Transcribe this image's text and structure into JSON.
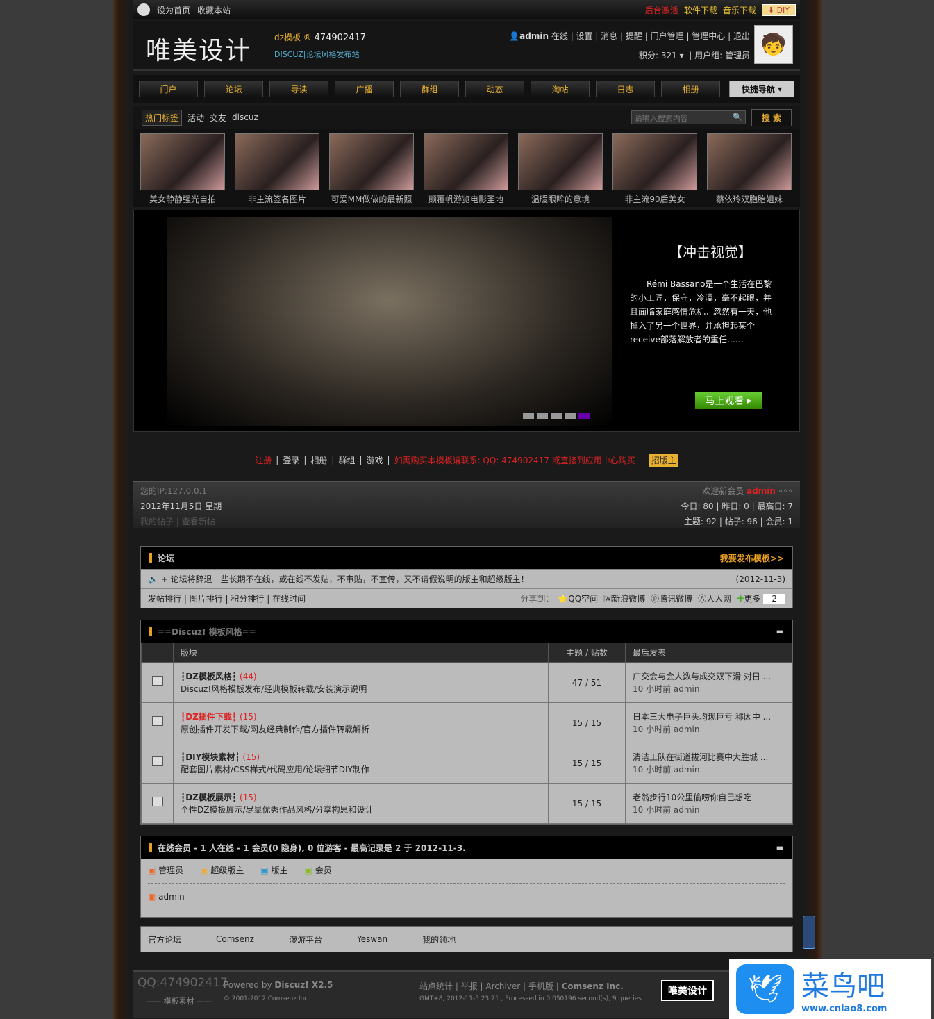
{
  "topbar": {
    "set_home": "设为首页",
    "bookmark": "收藏本站",
    "links": [
      "后台激活",
      "软件下载",
      "音乐下载"
    ],
    "diy": "DIY"
  },
  "header": {
    "logo": "唯美设计",
    "brand": "dz模板",
    "qq": "474902417",
    "tagline": "DISCUZ|论坛风格发布站",
    "user": "admin",
    "status": "在线",
    "menu": [
      "设置",
      "消息",
      "提醒",
      "门户管理",
      "管理中心",
      "退出"
    ],
    "credits": "积分: 321",
    "group": "用户组: 管理员"
  },
  "nav": {
    "items": [
      "门户",
      "论坛",
      "导读",
      "广播",
      "群组",
      "动态",
      "淘帖",
      "日志",
      "相册"
    ],
    "quick": "快捷导航"
  },
  "tags": {
    "label": "热门标签",
    "items": [
      "活动",
      "交友",
      "discuz"
    ],
    "search_placeholder": "请输入搜索内容",
    "search_btn": "搜 索"
  },
  "thumbs": [
    "美女静静强光自拍",
    "非主流签名图片",
    "可爱MM做做的最新照",
    "颠覆帆游览电影圣地",
    "温暖眼眸的意境",
    "非主流90后美女",
    "蔡依玲双胞胎姐妹"
  ],
  "banner": {
    "title": "【冲击视觉】",
    "text": "Rémi Bassano是一个生活在巴黎的小工匠，保守，冷漠，毫不起眼，并且面临家庭感情危机。忽然有一天，他掉入了另一个世界，并承担起某个receive部落解放者的重任……",
    "button": "马上观看"
  },
  "links": {
    "items": [
      "注册",
      "登录",
      "相册",
      "群组",
      "游戏"
    ],
    "notice": "如需购买本模板请联系: QQ: 474902417 或直接到应用中心购买",
    "badge": "招版主"
  },
  "stats": {
    "ip": "您的IP:127.0.0.1",
    "date": "2012年11月5日 星期一",
    "mine": "我的帖子",
    "new": "查看新帖",
    "welcome": "欢迎新会员",
    "new_member": "admin",
    "today": "今日: 80",
    "yesterday": "昨日: 0",
    "max": "最高日: 7",
    "topics": "主题: 92",
    "posts": "帖子: 96",
    "members": "会员: 1"
  },
  "forum": {
    "title": "论坛",
    "publish": "我要发布模板>>",
    "announcement": "+ 论坛将辞退一些长期不在线，或在线不发贴，不审贴，不宣传，又不请假说明的版主和超级版主！",
    "ann_date": "(2012-11-3)",
    "ranks": [
      "发帖排行",
      "图片排行",
      "积分排行",
      "在线时间"
    ],
    "share_label": "分享到：",
    "share": [
      "QQ空间",
      "新浪微博",
      "腾讯微博",
      "人人网",
      "更多"
    ],
    "share_count": "2"
  },
  "category": {
    "title": "==Discuz! 模板风格==",
    "cols": [
      "版块",
      "主题 / 贴数",
      "最后发表"
    ],
    "rows": [
      {
        "name": "┇DZ模板风格┇",
        "count": "(44)",
        "desc": "Discuz!风格模板发布/经典模板转载/安装演示说明",
        "stat": "47 / 51",
        "last": "广交会与会人数与成交双下滑 对日 ...",
        "time": "10 小时前 admin"
      },
      {
        "name": "┇DZ插件下载┇",
        "count": "(15)",
        "desc": "原创插件开发下载/网友经典制作/官方插件转载解析",
        "stat": "15 / 15",
        "last": "日本三大电子巨头均现巨亏 称因中 ...",
        "time": "10 小时前 admin"
      },
      {
        "name": "┇DIY模块素材┇",
        "count": "(15)",
        "desc": "配套图片素材/CSS样式/代码应用/论坛细节DIY制作",
        "stat": "15 / 15",
        "last": "清洁工队在街道拔河比赛中大胜城 ...",
        "time": "10 小时前 admin"
      },
      {
        "name": "┇DZ模板展示┇",
        "count": "(15)",
        "desc": "个性DZ模板展示/尽显优秀作品风格/分享构思和设计",
        "stat": "15 / 15",
        "last": "老翁步行10公里偷唠你自己想吃",
        "time": "10 小时前 admin"
      }
    ]
  },
  "online": {
    "title": "在线会员 - 1 人在线 - 1 会员(0 隐身), 0 位游客 - 最高记录是 2 于 2012-11-3.",
    "legend": [
      "管理员",
      "超级版主",
      "版主",
      "会员"
    ],
    "users": [
      "admin"
    ]
  },
  "friendlinks": [
    "官方论坛",
    "Comsenz",
    "漫游平台",
    "Yeswan",
    "我的领地"
  ],
  "footer": {
    "qq": "QQ:474902417",
    "sub": "—— 模板素材 ——",
    "powered": "Powered by",
    "product": "Discuz! X2.5",
    "copy": "© 2001-2012 Comsenz Inc.",
    "links": [
      "站点统计",
      "举报",
      "Archiver",
      "手机版",
      "Comsenz Inc."
    ],
    "info": "GMT+8, 2012-11-5 23:21 , Processed in 0.050196 second(s), 9 queries .",
    "badge": "唯美设计"
  },
  "watermark": {
    "text": "菜鸟吧",
    "url": "www.cniao8.com"
  }
}
